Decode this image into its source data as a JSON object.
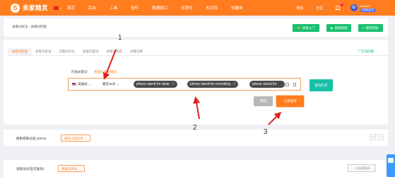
{
  "header": {
    "logo_mark": "S",
    "logo_text": "卖家精灵",
    "region_caret": "▾",
    "nav": [
      "首页",
      "后台",
      "工具",
      "插件",
      "数据接口",
      "优惠价",
      "知识库",
      "收藏夹"
    ],
    "right_links": [
      "购买",
      "社区"
    ],
    "bell_count": "3",
    "avatar_letter": "U",
    "user_name": "seller88",
    "user_tag": "经典版会员"
  },
  "breadcrumb": "关键词优化 › 关键词挖掘",
  "green_buttons": [
    "快速入门",
    "视频教程",
    "使用帮助"
  ],
  "tabs": [
    "关键词挖掘",
    "关键词反查",
    "流量词对比",
    "拓展流量词",
    "关键词追踪",
    "关键词库"
  ],
  "ad_link": "广告词挖掘",
  "search": {
    "subtabs": [
      "挖掘关键词",
      "批量分析关键词"
    ],
    "site": "美国站",
    "site_caret": "⌄",
    "time_range": "最近30天",
    "time_caret": "⌄",
    "keywords": [
      "phone stand for desk",
      "phone stand for recording",
      "phone stand for"
    ],
    "chip_close": "×",
    "history_button": "查询历史",
    "clear_button": "清除",
    "query_button": "立即查询"
  },
  "filters": {
    "label": "搜索结果过滤 (33ms)",
    "toggle": "展开过滤条件 ⌄",
    "icons": [
      "↻",
      "□"
    ]
  },
  "hf": {
    "label": "高频词(点击可查询)",
    "toggle": "隐藏高频词 ⌄",
    "export": "↓ 导出高频词"
  },
  "annotations": [
    "1",
    "2",
    "3"
  ],
  "colors": {
    "brand": "#ff7d1f",
    "green": "#18c06f",
    "teal": "#18c0a8"
  }
}
